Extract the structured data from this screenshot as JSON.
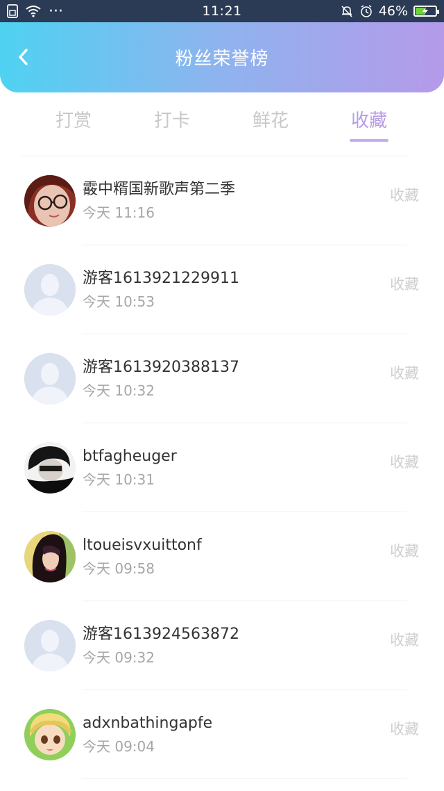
{
  "status_bar": {
    "time": "11:21",
    "battery_text": "46%",
    "battery_level": 0.46,
    "dots": "···",
    "icons": [
      "sim-icon",
      "wifi-icon",
      "bell-muted-icon",
      "alarm-icon",
      "battery-charging-icon"
    ]
  },
  "header": {
    "title": "粉丝荣誉榜",
    "back_icon": "chevron-left-icon"
  },
  "tabs": {
    "items": [
      {
        "label": "打赏"
      },
      {
        "label": "打卡"
      },
      {
        "label": "鲜花"
      },
      {
        "label": "收藏"
      }
    ],
    "active_index": 3
  },
  "list": {
    "rows": [
      {
        "name": "霰中糈国新歌声第二季",
        "time": "今天 11:16",
        "action": "收藏",
        "avatar": "photo-avatar-glasses"
      },
      {
        "name": "游客1613921229911",
        "time": "今天 10:53",
        "action": "收藏",
        "avatar": "default-avatar"
      },
      {
        "name": "游客1613920388137",
        "time": "今天 10:32",
        "action": "收藏",
        "avatar": "default-avatar"
      },
      {
        "name": "btfagheuger",
        "time": "今天 10:31",
        "action": "收藏",
        "avatar": "photo-avatar-dark"
      },
      {
        "name": "ltoueisvxuittonf",
        "time": "今天 09:58",
        "action": "收藏",
        "avatar": "photo-avatar-girl"
      },
      {
        "name": "游客1613924563872",
        "time": "今天 09:32",
        "action": "收藏",
        "avatar": "default-avatar"
      },
      {
        "name": "adxnbathingapfe",
        "time": "今天 09:04",
        "action": "收藏",
        "avatar": "cartoon-avatar"
      }
    ]
  },
  "colors": {
    "header_gradient_start": "#4fd2f2",
    "header_gradient_end": "#b59aea",
    "tab_active": "#b79be4",
    "tab_inactive": "#c8c8c8",
    "status_bar_bg": "#2b3a55"
  }
}
